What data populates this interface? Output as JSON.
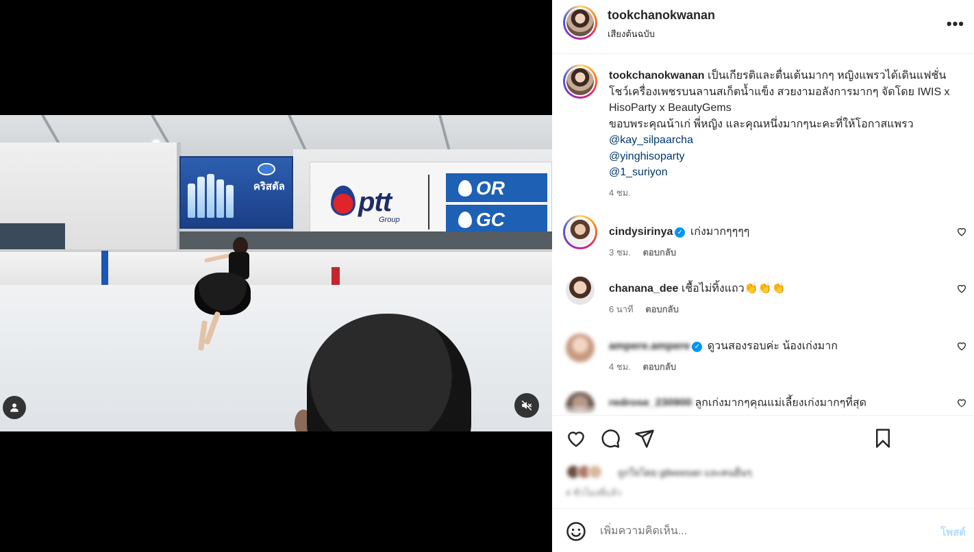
{
  "post": {
    "author": "tookchanokwanan",
    "audio": "เสียงต้นฉบับ",
    "more_label": "•••"
  },
  "caption": {
    "username": "tookchanokwanan",
    "text": "เป็นเกียรติและตื่นเต้นมากๆ หญิงแพรวได้เดินแฟชั่นโชว์เครื่องเพชรบนลานสเก็ตน้ำแข็ง สวยงามอลังการมากๆ จัดโดย IWIS x HisoParty x BeautyGems",
    "thanks": "ขอบพระคุณน้าเก่ พี่หญิง และคุณหนึ่งมากๆนะคะที่ให้โอกาสแพรว",
    "mentions": [
      "@kay_silpaarcha",
      "@yinghisoparty",
      "@1_suriyon"
    ],
    "time": "4 ชม."
  },
  "comments": [
    {
      "username": "cindysirinya",
      "verified": true,
      "text": "เก่งมากๆๆๆๆ",
      "time": "3 ชม.",
      "reply": "ตอบกลับ"
    },
    {
      "username": "chanana_dee",
      "verified": false,
      "text": "เชื้อไม่ทิ้งแถว👏👏👏",
      "time": "6 นาที",
      "reply": "ตอบกลับ"
    },
    {
      "username": "ampere.ampere",
      "verified": true,
      "text": "ดูวนสองรอบค่ะ น้องเก่งมาก",
      "time": "4 ชม.",
      "reply": "ตอบกลับ"
    },
    {
      "username": "redrose_230900",
      "verified": false,
      "text": "ลูกเก่งมากๆคุณแม่เลี้ยงเก่งมากๆที่สุด"
    }
  ],
  "likes": {
    "text": "ถูกใจโดย g8eeesan และคนอื่นๆ",
    "time": "4 ชั่วโมงที่แล้ว"
  },
  "composer": {
    "placeholder": "เพิ่มความคิดเห็น...",
    "post_label": "โพสต์"
  },
  "icons": {
    "avatar": "user-icon",
    "mute": "muted-speaker-icon",
    "like": "heart-icon",
    "comment": "comment-bubble-icon",
    "share": "paper-plane-icon",
    "save": "bookmark-icon",
    "emoji": "smiley-icon"
  },
  "colors": {
    "link": "#00376b",
    "verified": "#0095f6",
    "post_disabled": "#b3dbff"
  }
}
